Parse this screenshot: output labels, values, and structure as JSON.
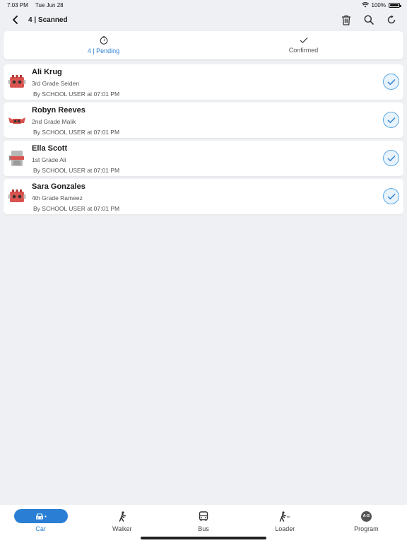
{
  "status_bar": {
    "time": "7:03 PM",
    "date": "Tue Jun 28",
    "battery": "100%"
  },
  "header": {
    "title": "4 | Scanned"
  },
  "tabs": [
    {
      "label": "4 | Pending",
      "icon": "timer-icon",
      "active": true
    },
    {
      "label": "Confirmed",
      "icon": "check-icon",
      "active": false
    }
  ],
  "students": [
    {
      "name": "Ali Krug",
      "grade": "3rd Grade Seiden",
      "by": "By SCHOOL USER at 07:01 PM"
    },
    {
      "name": "Robyn Reeves",
      "grade": "2nd Grade Malik",
      "by": "By SCHOOL USER at 07:01 PM"
    },
    {
      "name": "Ella Scott",
      "grade": "1st Grade Ali",
      "by": "By SCHOOL USER at 07:01 PM"
    },
    {
      "name": "Sara Gonzales",
      "grade": "4th Grade Rameez",
      "by": "By SCHOOL USER at 07:01 PM"
    }
  ],
  "bottom_nav": [
    {
      "label": "Car",
      "icon": "car-icon",
      "active": true
    },
    {
      "label": "Walker",
      "icon": "walker-icon",
      "active": false
    },
    {
      "label": "Bus",
      "icon": "bus-icon",
      "active": false
    },
    {
      "label": "Loader",
      "icon": "loader-icon",
      "active": false
    },
    {
      "label": "Program",
      "icon": "program-icon",
      "badge": "A-S",
      "active": false
    }
  ],
  "colors": {
    "accent": "#2a7fd4",
    "background": "#eef0f3",
    "check_border": "#5aa9e6"
  }
}
